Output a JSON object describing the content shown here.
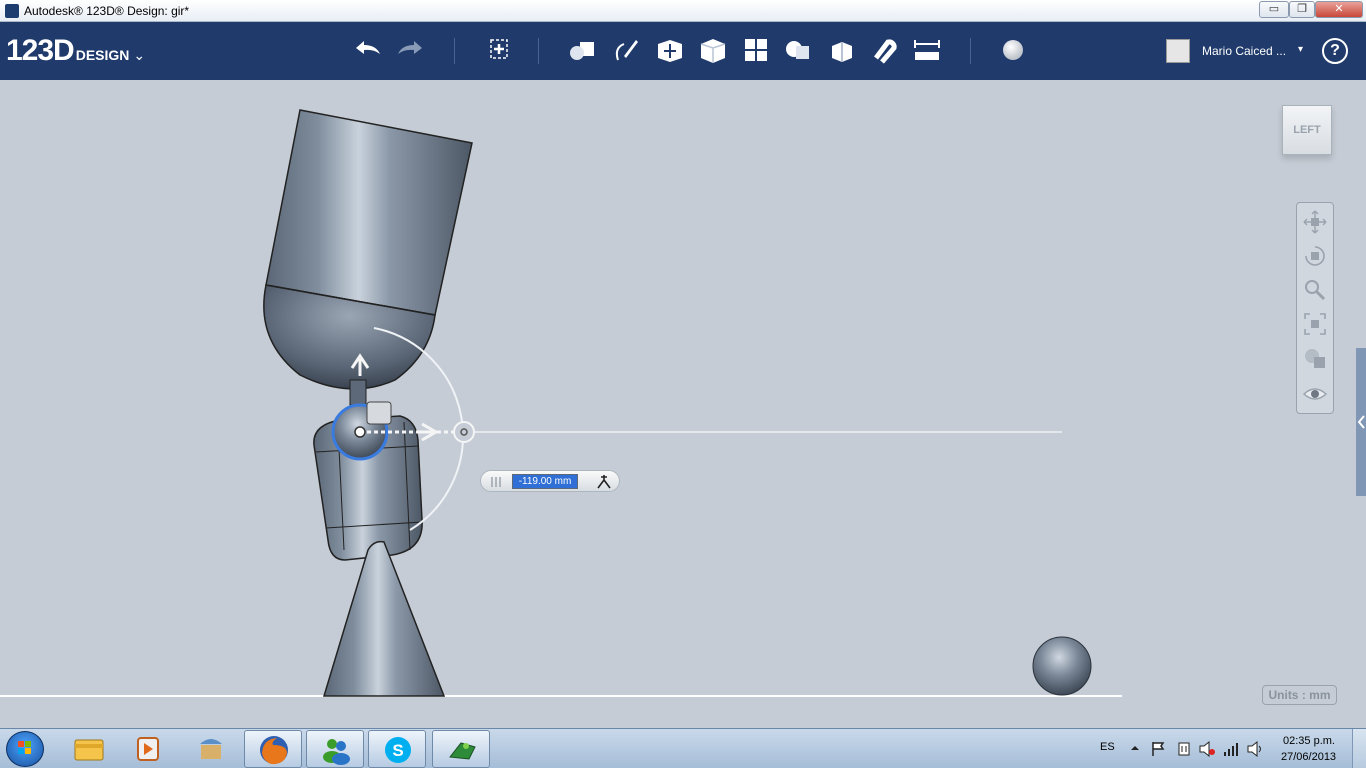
{
  "window": {
    "title": "Autodesk® 123D® Design: gir*",
    "buttons": [
      "▭",
      "❐",
      "✕"
    ]
  },
  "toolbar": {
    "logo_big": "123D",
    "logo_small": "DESIGN",
    "logo_caret": "⌄",
    "tools": [
      {
        "name": "undo-icon"
      },
      {
        "name": "redo-icon"
      },
      {
        "name": "transform-icon"
      },
      {
        "name": "primitives-icon"
      },
      {
        "name": "sketch-icon"
      },
      {
        "name": "construct-icon"
      },
      {
        "name": "modify-icon"
      },
      {
        "name": "pattern-icon"
      },
      {
        "name": "group-icon"
      },
      {
        "name": "combine-icon"
      },
      {
        "name": "snap-icon"
      },
      {
        "name": "measure-icon"
      },
      {
        "name": "material-icon"
      }
    ],
    "user_name": "Mario Caiced ...",
    "user_caret": "▾",
    "help_label": "?"
  },
  "viewport": {
    "dimension_value": "-119.00 mm",
    "viewcube_label": "LEFT",
    "nav_tools": [
      "pan-icon",
      "orbit-icon",
      "zoom-icon",
      "fit-icon",
      "view-mode-icon",
      "visibility-icon"
    ],
    "units_label": "Units : mm"
  },
  "taskbar": {
    "apps": [
      "explorer-icon",
      "media-player-icon",
      "app-store-icon",
      "firefox-icon",
      "messenger-icon",
      "skype-icon",
      "123d-design-icon"
    ],
    "language": "ES",
    "time": "02:35 p.m.",
    "date": "27/06/2013"
  },
  "colors": {
    "toolbar_bg": "#1f3a6b",
    "viewport_bg": "#c5ccd5",
    "selection_blue": "#3a7be0"
  }
}
